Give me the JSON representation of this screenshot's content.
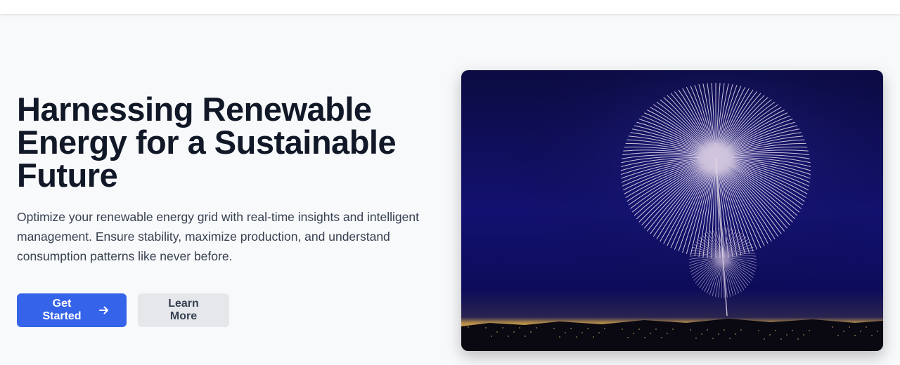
{
  "hero": {
    "title_line1": "Harnessing Renewable",
    "title_line2": "Energy for a Sustainable",
    "title_line3": "Future",
    "description": "Optimize your renewable energy grid with real-time insights and intelligent management. Ensure stability, maximize production, and understand consumption patterns like never before.",
    "primary_button": "Get Started",
    "secondary_button": "Learn More",
    "primary_icon": "arrow-right-icon",
    "image_subject": "fireworks-night-sky"
  },
  "colors": {
    "primary": "#3563e9",
    "secondary_bg": "#e5e7eb",
    "title": "#111827",
    "text": "#374151",
    "page_bg": "#f8f9fb"
  }
}
